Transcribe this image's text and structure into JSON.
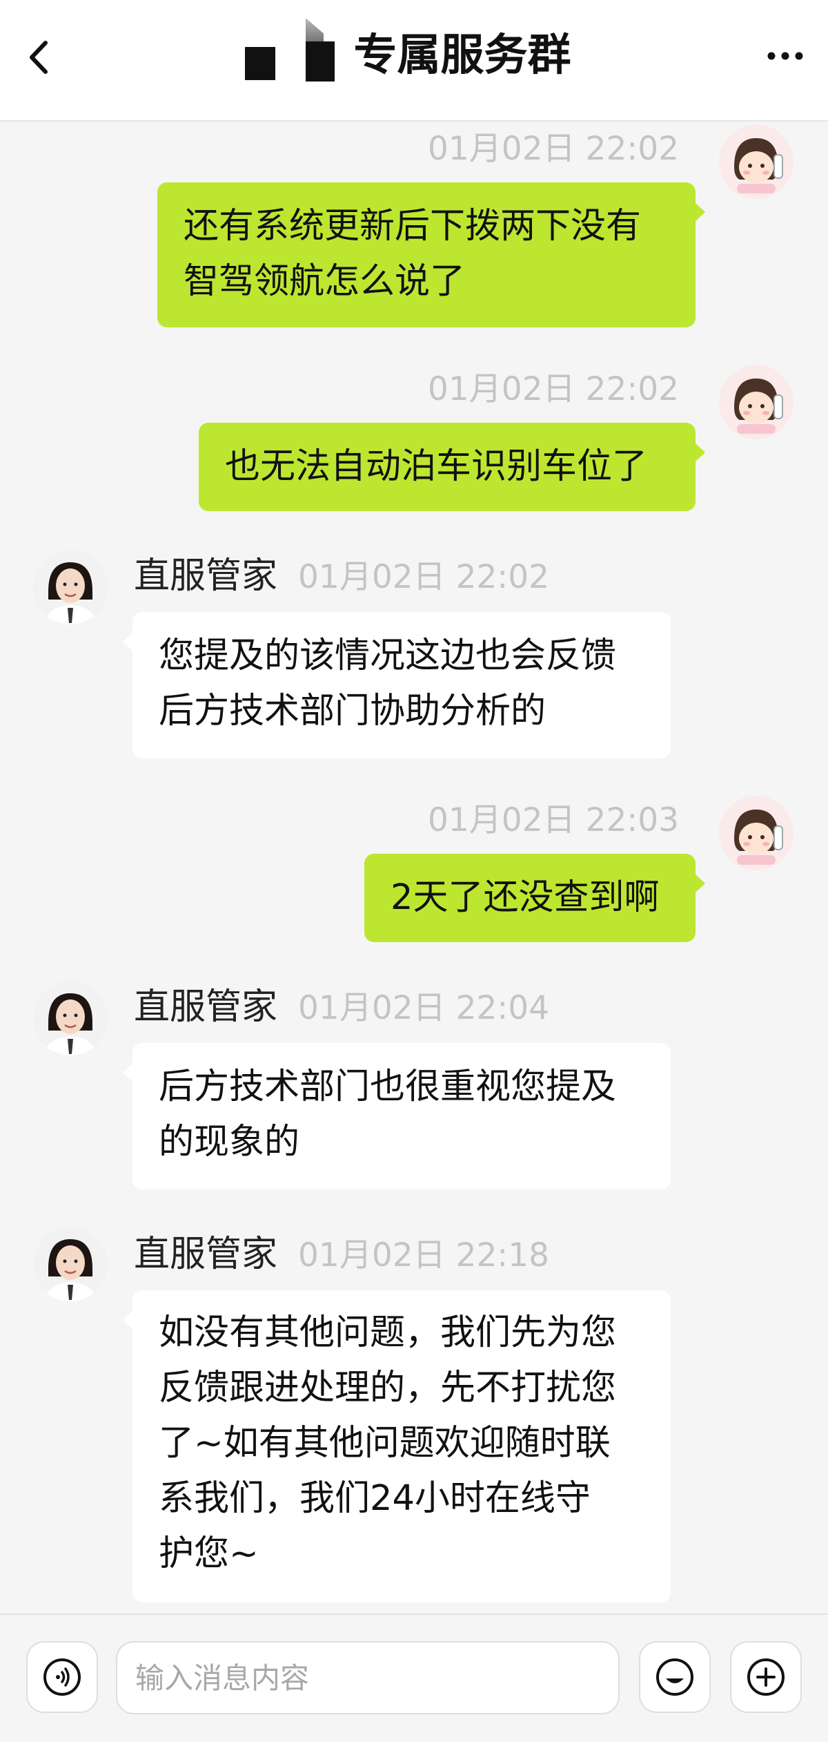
{
  "header": {
    "title": "专属服务群"
  },
  "agent": {
    "name": "直服管家"
  },
  "messages": [
    {
      "side": "out",
      "time": "01月02日 22:02",
      "lines": [
        "还有系统更新后下拨两下没有",
        "智驾领航怎么说了"
      ]
    },
    {
      "side": "out",
      "time": "01月02日 22:02",
      "lines": [
        "也无法自动泊车识别车位了"
      ]
    },
    {
      "side": "in",
      "time": "01月02日 22:02",
      "lines": [
        "您提及的该情况这边也会反馈",
        "后方技术部门协助分析的"
      ]
    },
    {
      "side": "out",
      "time": "01月02日 22:03",
      "lines": [
        "2天了还没查到啊"
      ]
    },
    {
      "side": "in",
      "time": "01月02日 22:04",
      "lines": [
        "后方技术部门也很重视您提及",
        "的现象的"
      ]
    },
    {
      "side": "in",
      "time": "01月02日 22:18",
      "lines": [
        "如没有其他问题，我们先为您",
        "反馈跟进处理的，先不打扰您",
        "了~如有其他问题欢迎随时联",
        "系我们，我们24小时在线守",
        "护您~"
      ]
    }
  ],
  "input": {
    "placeholder": "输入消息内容"
  },
  "icons": {
    "back": "chevron-left-icon",
    "more": "more-dots-icon",
    "voice": "voice-icon",
    "emoji": "emoji-icon",
    "add": "plus-circle-icon"
  },
  "colors": {
    "outgoing_bubble": "#bde630",
    "incoming_bubble": "#ffffff",
    "background": "#f5f5f5",
    "timestamp": "#c4c4c4"
  }
}
